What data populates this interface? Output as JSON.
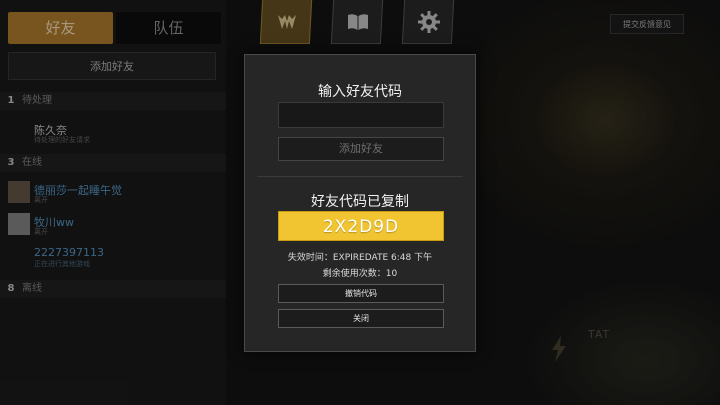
{
  "sidebar": {
    "tabs": [
      {
        "label": "好友",
        "active": true
      },
      {
        "label": "队伍",
        "active": false
      }
    ],
    "add_friend_label": "添加好友",
    "sections": [
      {
        "count": "1",
        "title": "待处理"
      },
      {
        "count": "3",
        "title": "在线"
      },
      {
        "count": "8",
        "title": "离线"
      }
    ],
    "pending": [
      {
        "name": "陈久奈",
        "status": "待处理的好友请求"
      }
    ],
    "online": [
      {
        "name": "德丽莎一起睡午觉",
        "status": "离开"
      },
      {
        "name": "牧川ww",
        "status": "离开"
      },
      {
        "name": "2227397113",
        "status": "正在进行其他游戏"
      }
    ]
  },
  "topbar": {
    "icons": [
      "gauntlet-icon",
      "book-icon",
      "gear-icon"
    ],
    "feedback_label": "提交反馈意见"
  },
  "background": {
    "scene_text": "TAT"
  },
  "modal": {
    "enter_code_title": "输入好友代码",
    "code_input_value": "",
    "add_friend_label": "添加好友",
    "copied_title": "好友代码已复制",
    "friend_code": "2X2D9D",
    "expire_text": "失效时间：EXPIREDATE 6:48 下午",
    "remaining_text": "剩余使用次数：10",
    "revoke_label": "撤销代码",
    "close_label": "关闭"
  },
  "colors": {
    "accent_gold": "#b8822e",
    "code_yellow": "#f1c531",
    "online_blue": "#5a9fd0",
    "pending_text": "#d0d0d0"
  }
}
